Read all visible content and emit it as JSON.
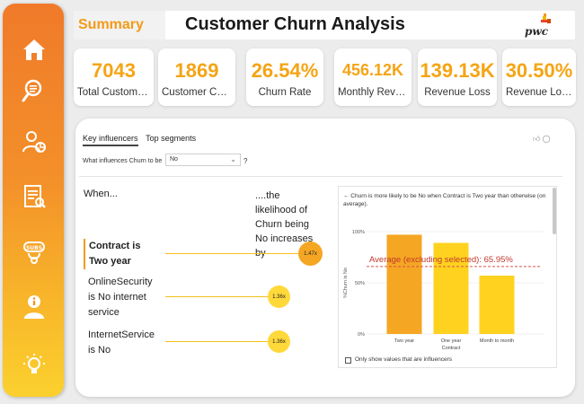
{
  "header": {
    "summary_tab": "Summary",
    "title": "Customer Churn Analysis",
    "logo_text": "pwc"
  },
  "sidebar": {
    "items": [
      {
        "icon": "home-icon"
      },
      {
        "icon": "search-document-icon"
      },
      {
        "icon": "user-analytics-icon"
      },
      {
        "icon": "report-icon"
      },
      {
        "icon": "subscription-icon"
      },
      {
        "icon": "info-person-icon"
      },
      {
        "icon": "lightbulb-icon"
      }
    ]
  },
  "kpis": [
    {
      "value": "7043",
      "label": "Total Customer..."
    },
    {
      "value": "1869",
      "label": "Customer Churn"
    },
    {
      "value": "26.54%",
      "label": "Churn Rate"
    },
    {
      "value": "456.12K",
      "label": "Monthly Revenu..."
    },
    {
      "value": "139.13K",
      "label": "Revenue Loss"
    },
    {
      "value": "30.50%",
      "label": "Revenue Loss%"
    }
  ],
  "influencers": {
    "tabs": [
      "Key influencers",
      "Top segments"
    ],
    "question": "What influences Churn to be",
    "selected_value": "No",
    "question_mark": "?",
    "when_header": "When...",
    "likelihood_header": "....the likelihood of Churn being No increases by",
    "items": [
      {
        "label": "Contract is Two year",
        "factor": "1.47x",
        "selected": true
      },
      {
        "label": "OnlineSecurity is No internet service",
        "factor": "1.36x",
        "selected": false
      },
      {
        "label": "InternetService is No",
        "factor": "1.36x",
        "selected": false
      }
    ]
  },
  "detail_chart": {
    "note": "←  Churn is more likely to be No when Contract is Two year than otherwise (on average).",
    "checkbox_label": "Only show values that are influencers",
    "average_label": "Average (excluding selected): 65.95%",
    "colors": {
      "selected": "#f5a623",
      "other": "#ffd21f",
      "avg_line": "#d9534f",
      "avg_text": "#c0392b"
    }
  },
  "chart_data": {
    "type": "bar",
    "categories": [
      "Two year",
      "One year",
      "Month to month"
    ],
    "values": [
      97,
      89,
      57
    ],
    "xlabel": "Contract",
    "ylabel": "%Churn is No",
    "yticks": [
      "0%",
      "50%",
      "100%"
    ],
    "ylim": [
      0,
      100
    ],
    "average": 65.95
  }
}
